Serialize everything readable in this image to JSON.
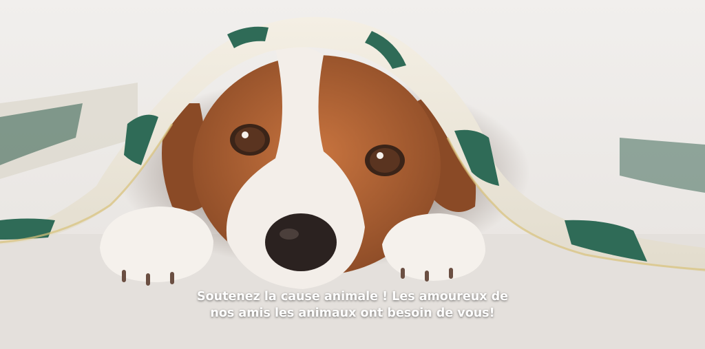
{
  "caption": {
    "line1": "Soutenez la cause animale ! Les amoureux de",
    "line2": "nos amis les animaux ont besoin de vous!"
  },
  "colors": {
    "background": "#ece9e6",
    "blanket_teal": "#2f6b57",
    "blanket_cream": "#efe8d8",
    "fur_brown": "#b5673a",
    "text": "#ffffff"
  },
  "icons": {
    "photo": "dog-under-blanket-icon"
  }
}
